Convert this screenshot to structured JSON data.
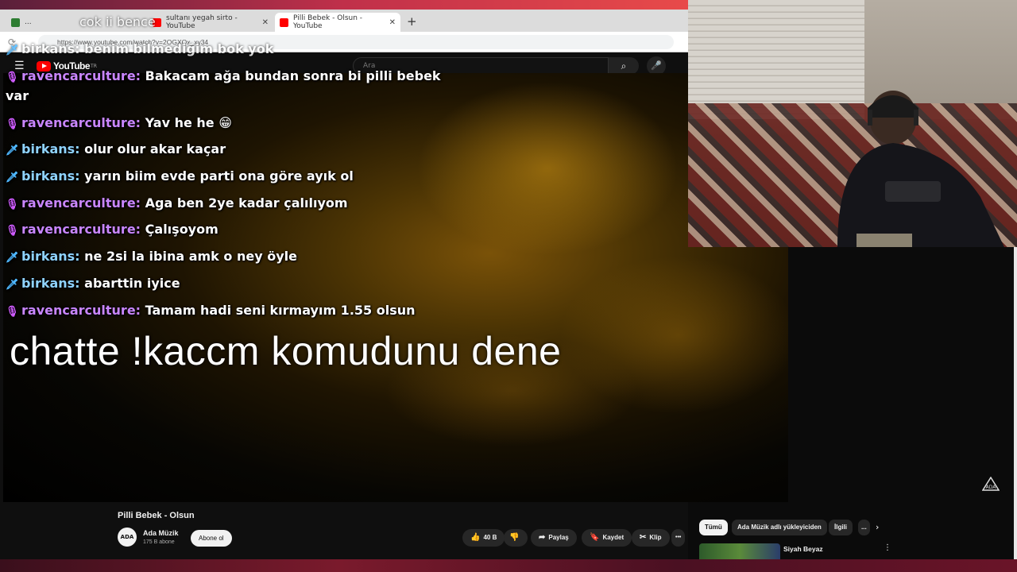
{
  "overlay_top_text": "cok ii bence",
  "browser": {
    "tabs": [
      {
        "label": "...",
        "favicon_color": "#2e7d32",
        "active": false
      },
      {
        "label": "sultanı yegah sirto - YouTube",
        "favicon_color": "#ff0000",
        "active": false
      },
      {
        "label": "Pilli Bebek - Olsun - YouTube",
        "favicon_color": "#ff0000",
        "active": true
      }
    ],
    "new_tab": "+",
    "url": "https://www.youtube.com/watch?v=2OGXQx_xy34"
  },
  "youtube": {
    "logo": "YouTube",
    "logo_suffix": "TR",
    "search_placeholder": "Ara"
  },
  "chat": {
    "top_partial": "birkans: benim bilmediğim bok yok",
    "messages": [
      {
        "user": "ravencarculture:",
        "text": "Bakacam ağa bundan sonra bi pilli bebek",
        "role": "mic"
      },
      {
        "user": "",
        "text": "var",
        "role": "cont"
      },
      {
        "user": "ravencarculture:",
        "text": "Yav he he 😁",
        "role": "mic"
      },
      {
        "user": "birkans:",
        "text": "olur olur akar kaçar",
        "role": "sword"
      },
      {
        "user": "birkans:",
        "text": "yarın biim evde parti ona göre ayık ol",
        "role": "sword"
      },
      {
        "user": "ravencarculture:",
        "text": "Aga ben 2ye kadar çalılıyom",
        "role": "mic"
      },
      {
        "user": "ravencarculture:",
        "text": "Çalışoyom",
        "role": "mic"
      },
      {
        "user": "birkans:",
        "text": "ne 2si la ibina amk o ney öyle",
        "role": "sword"
      },
      {
        "user": "birkans:",
        "text": "abarttin iyice",
        "role": "sword"
      },
      {
        "user": "ravencarculture:",
        "text": "Tamam hadi seni kırmayım 1.55 olsun",
        "role": "mic"
      }
    ]
  },
  "big_overlay": "chatte !kaccm komudunu dene",
  "video_info": {
    "title": "Pilli Bebek - Olsun",
    "channel": "Ada Müzik",
    "subscribers": "175 B abone",
    "avatar_text": "ADA",
    "subscribe": "Abone ol",
    "likes": "40 B",
    "share": "Paylaş",
    "save": "Kaydet",
    "clip": "Klip",
    "more": "•••"
  },
  "sidebar": {
    "chips": [
      "Tümü",
      "Ada Müzik adlı yükleyiciden",
      "İlgili",
      "..."
    ],
    "next": "›",
    "rec_title": "Siyah Beyaz"
  },
  "colors": {
    "username_mic": "#c986ff",
    "username_sword": "#8fd3ff",
    "youtube_red": "#ff0000"
  }
}
